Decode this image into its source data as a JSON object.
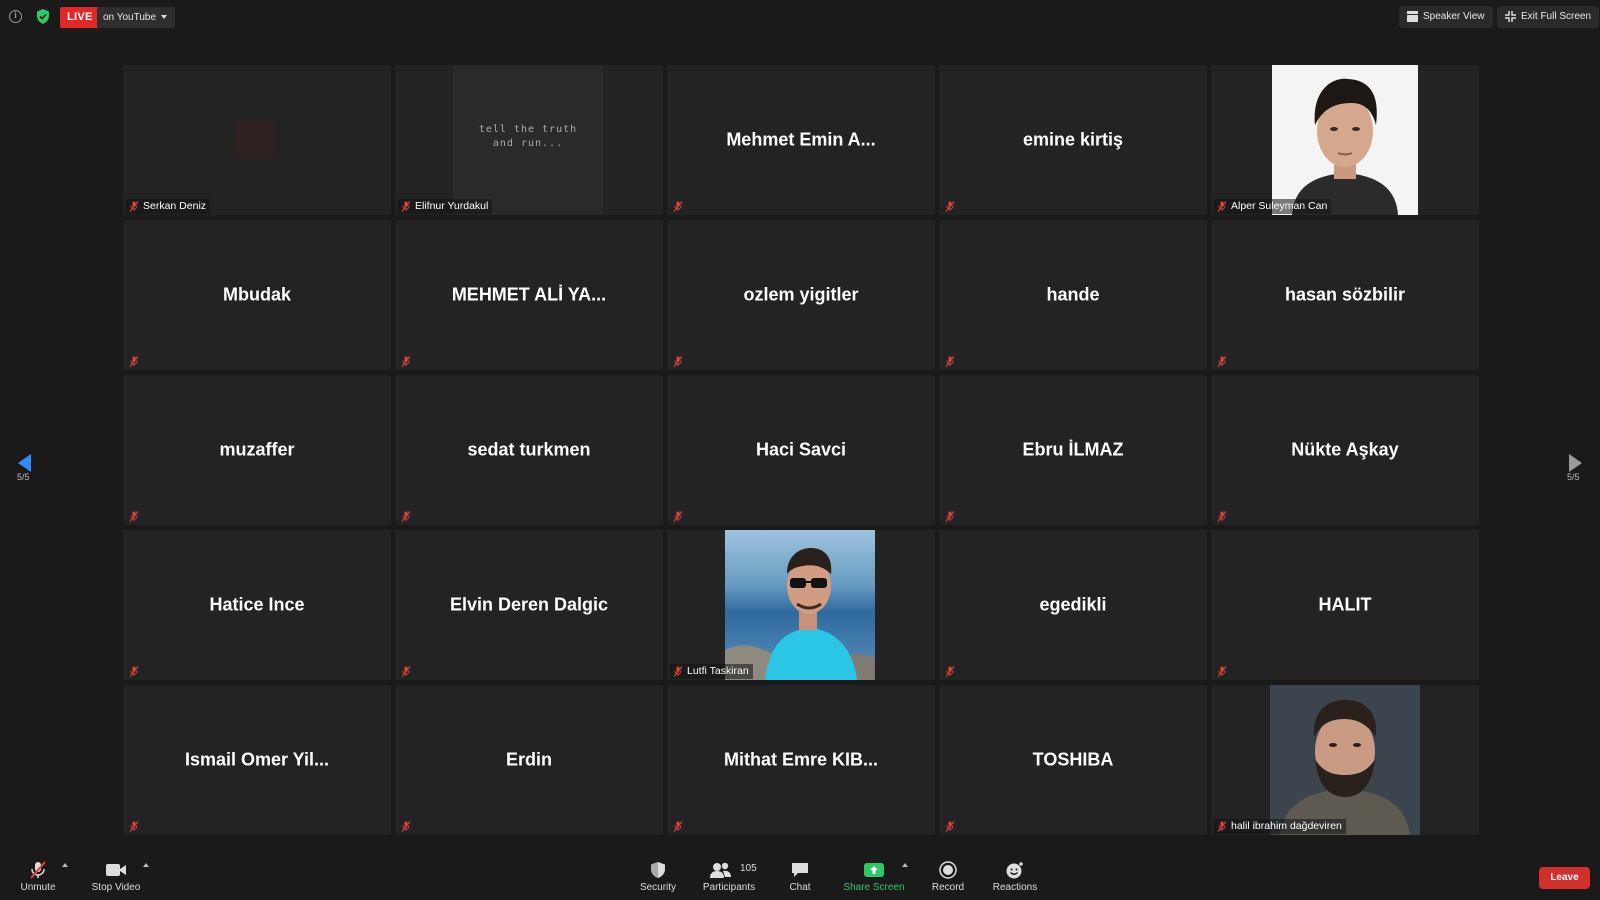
{
  "topbar": {
    "live_badge": "LIVE",
    "stream_target": "on YouTube",
    "speaker_view": "Speaker View",
    "exit_full_screen": "Exit Full Screen"
  },
  "pagination": {
    "left": "5/5",
    "right": "5/5"
  },
  "participants": [
    {
      "display_name": "",
      "label": "Serkan Deniz",
      "video": "camera-dark"
    },
    {
      "display_name": "",
      "label": "Elifnur Yurdakul",
      "video": "handwriting-image",
      "image_text_1": "tell the truth",
      "image_text_2": "and run..."
    },
    {
      "display_name": "Mehmet Emin A...",
      "label": "",
      "video": "off"
    },
    {
      "display_name": "emine kirtiş",
      "label": "",
      "video": "off"
    },
    {
      "display_name": "",
      "label": "Alper Suleyman Can",
      "video": "photo-portrait"
    },
    {
      "display_name": "Mbudak",
      "label": "",
      "video": "off"
    },
    {
      "display_name": "MEHMET ALİ YA...",
      "label": "",
      "video": "off"
    },
    {
      "display_name": "ozlem yigitler",
      "label": "",
      "video": "off"
    },
    {
      "display_name": "hande",
      "label": "",
      "video": "off"
    },
    {
      "display_name": "hasan sözbilir",
      "label": "",
      "video": "off"
    },
    {
      "display_name": "muzaffer",
      "label": "",
      "video": "off"
    },
    {
      "display_name": "sedat turkmen",
      "label": "",
      "video": "off"
    },
    {
      "display_name": "Haci Savci",
      "label": "",
      "video": "off"
    },
    {
      "display_name": "Ebru İLMAZ",
      "label": "",
      "video": "off"
    },
    {
      "display_name": "Nükte Aşkay",
      "label": "",
      "video": "off"
    },
    {
      "display_name": "Hatice Ince",
      "label": "",
      "video": "off"
    },
    {
      "display_name": "Elvin Deren Dalgic",
      "label": "",
      "video": "off"
    },
    {
      "display_name": "",
      "label": "Lutfi Taskiran",
      "video": "photo-sea"
    },
    {
      "display_name": "egedikli",
      "label": "",
      "video": "off"
    },
    {
      "display_name": "HALIT",
      "label": "",
      "video": "off"
    },
    {
      "display_name": "Ismail Omer Yil...",
      "label": "",
      "video": "off"
    },
    {
      "display_name": "Erdin",
      "label": "",
      "video": "off"
    },
    {
      "display_name": "Mithat Emre KIB...",
      "label": "",
      "video": "off"
    },
    {
      "display_name": "TOSHIBA",
      "label": "",
      "video": "off"
    },
    {
      "display_name": "",
      "label": "halil ibrahim dağdeviren",
      "video": "photo-portrait-beard"
    }
  ],
  "toolbar": {
    "unmute": "Unmute",
    "stop_video": "Stop Video",
    "security": "Security",
    "participants": "Participants",
    "participants_count": "105",
    "chat": "Chat",
    "share_screen": "Share Screen",
    "record": "Record",
    "reactions": "Reactions",
    "leave": "Leave"
  },
  "colors": {
    "live_red": "#e02828",
    "share_green": "#2ec866",
    "leave_red": "#d1302c",
    "mic_muted_red": "#e0453a",
    "nav_arrow_blue": "#2d8cff"
  }
}
